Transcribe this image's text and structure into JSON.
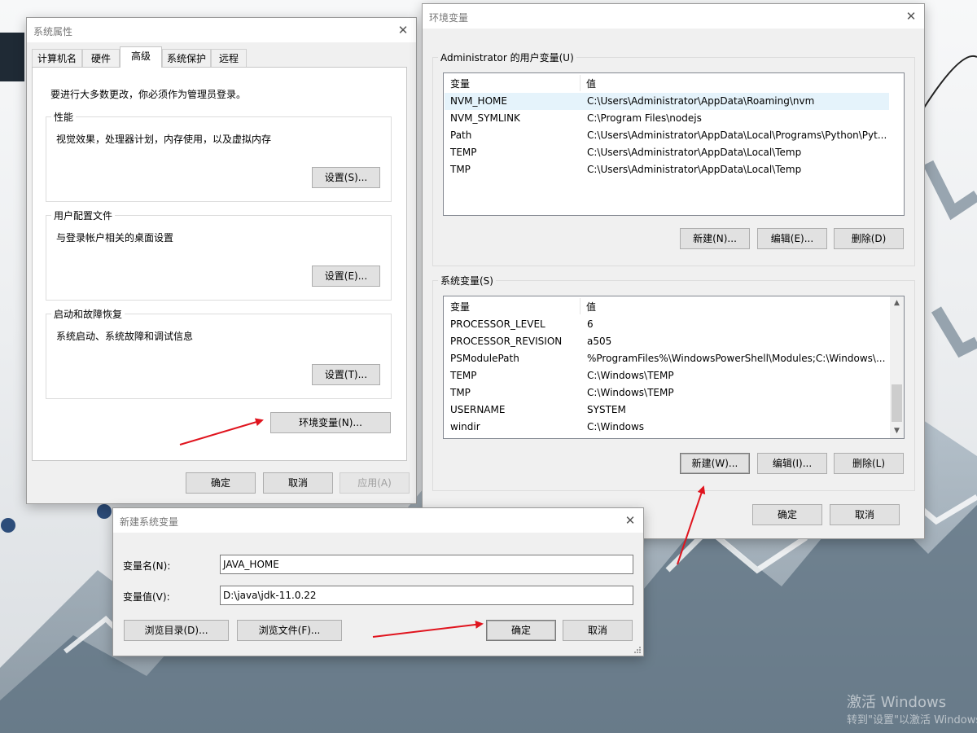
{
  "system_properties": {
    "title": "系统属性",
    "tabs": [
      "计算机名",
      "硬件",
      "高级",
      "系统保护",
      "远程"
    ],
    "admin_note": "要进行大多数更改，你必须作为管理员登录。",
    "performance": {
      "label": "性能",
      "desc": "视觉效果，处理器计划，内存使用，以及虚拟内存",
      "button": "设置(S)..."
    },
    "user_profiles": {
      "label": "用户配置文件",
      "desc": "与登录帐户相关的桌面设置",
      "button": "设置(E)..."
    },
    "startup_recovery": {
      "label": "启动和故障恢复",
      "desc": "系统启动、系统故障和调试信息",
      "button": "设置(T)..."
    },
    "env_button": "环境变量(N)...",
    "ok": "确定",
    "cancel": "取消",
    "apply": "应用(A)"
  },
  "env_vars": {
    "title": "环境变量",
    "user_section": "Administrator 的用户变量(U)",
    "col_var": "变量",
    "col_val": "值",
    "user_vars": [
      {
        "name": "NVM_HOME",
        "value": "C:\\Users\\Administrator\\AppData\\Roaming\\nvm"
      },
      {
        "name": "NVM_SYMLINK",
        "value": "C:\\Program Files\\nodejs"
      },
      {
        "name": "Path",
        "value": "C:\\Users\\Administrator\\AppData\\Local\\Programs\\Python\\Pyt..."
      },
      {
        "name": "TEMP",
        "value": "C:\\Users\\Administrator\\AppData\\Local\\Temp"
      },
      {
        "name": "TMP",
        "value": "C:\\Users\\Administrator\\AppData\\Local\\Temp"
      }
    ],
    "user_buttons": {
      "new": "新建(N)...",
      "edit": "编辑(E)...",
      "delete": "删除(D)"
    },
    "system_section": "系统变量(S)",
    "system_vars": [
      {
        "name": "PROCESSOR_LEVEL",
        "value": "6"
      },
      {
        "name": "PROCESSOR_REVISION",
        "value": "a505"
      },
      {
        "name": "PSModulePath",
        "value": "%ProgramFiles%\\WindowsPowerShell\\Modules;C:\\Windows\\..."
      },
      {
        "name": "TEMP",
        "value": "C:\\Windows\\TEMP"
      },
      {
        "name": "TMP",
        "value": "C:\\Windows\\TEMP"
      },
      {
        "name": "USERNAME",
        "value": "SYSTEM"
      },
      {
        "name": "windir",
        "value": "C:\\Windows"
      }
    ],
    "system_buttons": {
      "new": "新建(W)...",
      "edit": "编辑(I)...",
      "delete": "删除(L)"
    },
    "ok": "确定",
    "cancel": "取消"
  },
  "new_var_dialog": {
    "title": "新建系统变量",
    "name_label": "变量名(N):",
    "name_value": "JAVA_HOME",
    "value_label": "变量值(V):",
    "value_value": "D:\\java\\jdk-11.0.22",
    "browse_dir": "浏览目录(D)...",
    "browse_file": "浏览文件(F)...",
    "ok": "确定",
    "cancel": "取消"
  },
  "desktop": {
    "watermark_line1": "激活 Windows",
    "watermark_line2": "转到\"设置\"以激活 Windows。",
    "annotation_color": "#e0141e"
  }
}
